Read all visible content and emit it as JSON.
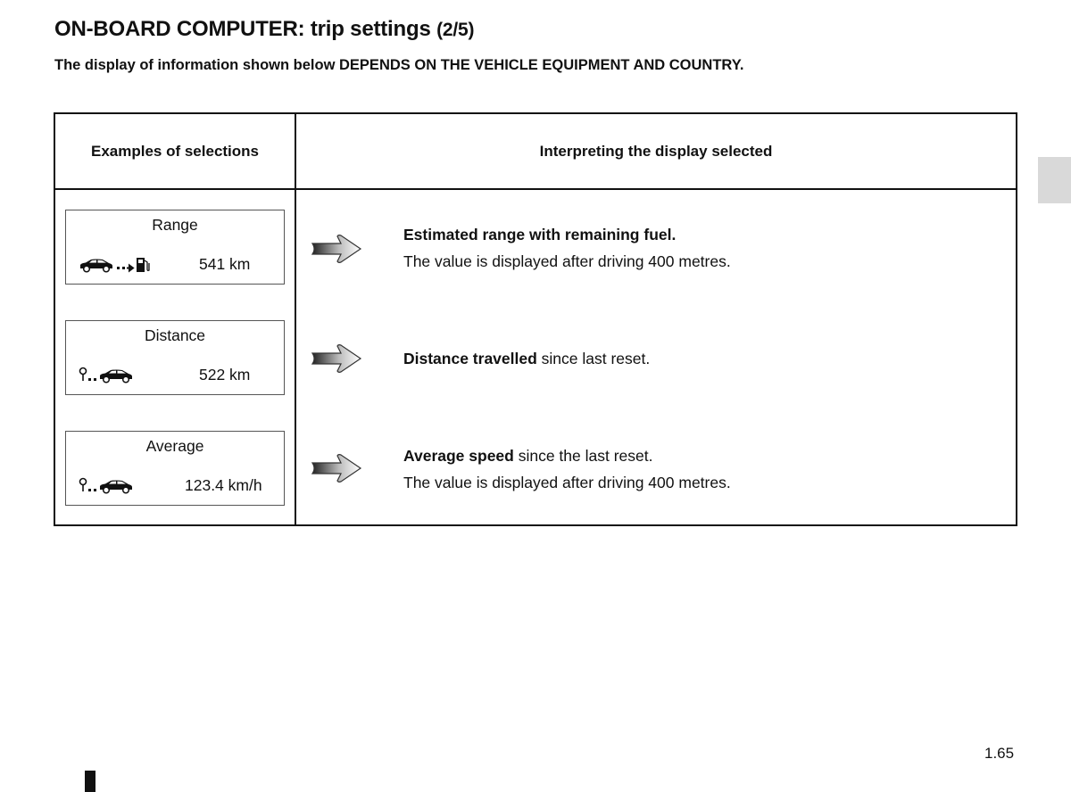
{
  "header": {
    "title": "ON-BOARD COMPUTER: trip settings",
    "page_count": "(2/5)",
    "subtitle": "The display of information shown below DEPENDS ON THE VEHICLE EQUIPMENT AND COUNTRY."
  },
  "table": {
    "columns": [
      "Examples of selections",
      "Interpreting the display selected"
    ],
    "rows": [
      {
        "display_label": "Range",
        "display_value": "541 km",
        "icon": "car-to-fuel-pump-icon",
        "desc_bold": "Estimated range with remaining fuel.",
        "desc_rest": "",
        "desc_line2": "The value is displayed after driving 400 metres."
      },
      {
        "display_label": "Distance",
        "display_value": "522 km",
        "icon": "start-point-to-car-icon",
        "desc_bold": "Distance travelled",
        "desc_rest": " since last reset.",
        "desc_line2": ""
      },
      {
        "display_label": "Average",
        "display_value": "123.4 km/h",
        "icon": "start-point-to-car-icon",
        "desc_bold": "Average speed",
        "desc_rest": " since the last reset.",
        "desc_line2": "The value is displayed after driving 400 metres."
      }
    ]
  },
  "footer": {
    "page_number": "1.65"
  },
  "colors": {
    "text": "#111111",
    "side_tab": "#d9d9d9",
    "background": "#ffffff"
  }
}
